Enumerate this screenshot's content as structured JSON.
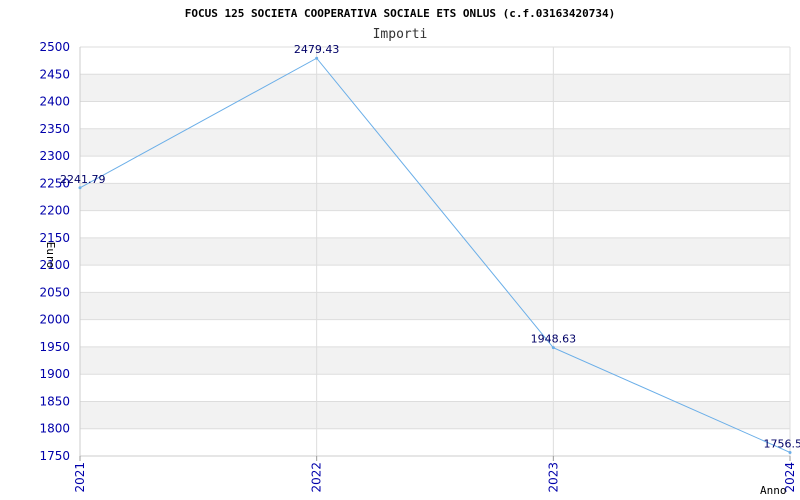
{
  "chart_data": {
    "type": "line",
    "title": "FOCUS 125 SOCIETA COOPERATIVA SOCIALE ETS ONLUS (c.f.03163420734)",
    "subtitle": "Importi",
    "xlabel": "Anno",
    "ylabel": "Euro",
    "categories": [
      "2021",
      "2022",
      "2023",
      "2024"
    ],
    "series": [
      {
        "values": [
          2241.79,
          2479.43,
          1948.63,
          1756.5
        ],
        "labels": [
          "2241.79",
          "2479.43",
          "1948.63",
          "1756.5"
        ]
      }
    ],
    "ylim": [
      1750,
      2500
    ],
    "yticks": [
      "1750",
      "1800",
      "1850",
      "1900",
      "1950",
      "2000",
      "2050",
      "2100",
      "2150",
      "2200",
      "2250",
      "2300",
      "2350",
      "2400",
      "2450",
      "2500"
    ],
    "grid": true,
    "colors": {
      "line": "#6aaee8",
      "band": "#f2f2f2",
      "tick_text": "#0000aa",
      "data_label": "#000066"
    }
  }
}
